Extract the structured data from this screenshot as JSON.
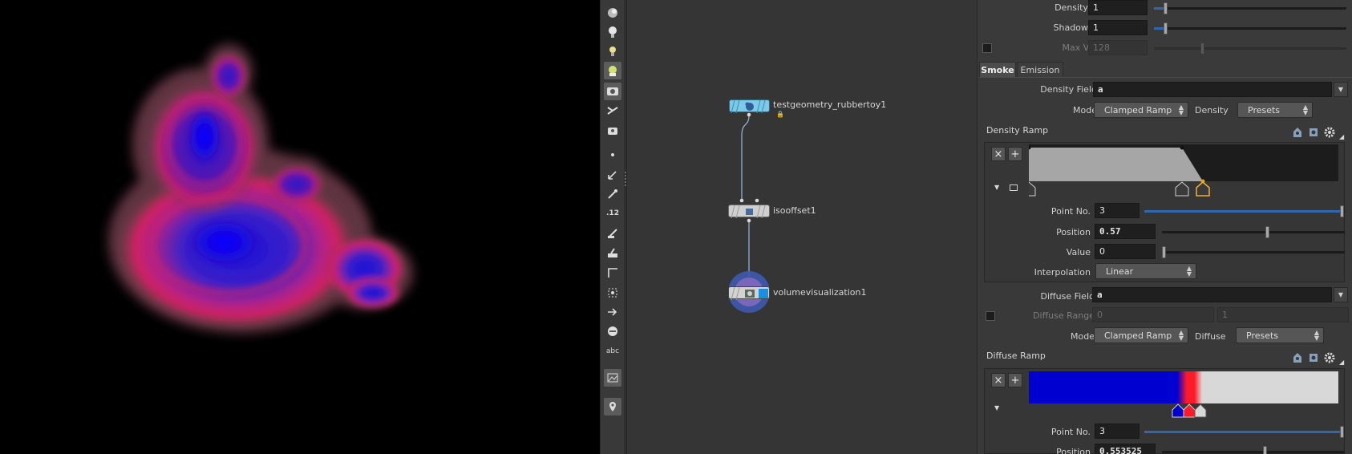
{
  "network": {
    "nodes": [
      {
        "name": "testgeometry_rubbertoy1"
      },
      {
        "name": "isooffset1"
      },
      {
        "name": "volumevisualization1"
      }
    ]
  },
  "toolbar": {
    "icons": [
      "display-options-icon",
      "light-icon",
      "light-bulb-icon",
      "camera-icon",
      "snapshot-icon",
      "visualizer-icon",
      "render-icon",
      "point-icon",
      "select-normal-icon",
      "pen-icon",
      "number-12-icon",
      "brush-icon",
      "paint-icon",
      "corner-icon",
      "grid-snap-icon",
      "arrow-tool-icon",
      "circle-icon",
      "text-abc-icon",
      "background-image-icon",
      "location-pin-icon"
    ]
  },
  "params": {
    "density_scale": {
      "label": "Density Scale",
      "value": "1",
      "slider": 0.05
    },
    "shadow_scale": {
      "label": "Shadow Scale",
      "value": "1",
      "slider": 0.05
    },
    "max_vis_res": {
      "label": "Max Vis Res",
      "value": "128"
    },
    "tabs": [
      {
        "label": "Smoke"
      },
      {
        "label": "Emission"
      }
    ],
    "density_field": {
      "label": "Density Field",
      "value": "a"
    },
    "density_mode": {
      "label": "Mode",
      "value": "Clamped Ramp",
      "aux_label": "Density",
      "presets": "Presets"
    },
    "density_ramp": {
      "title": "Density Ramp",
      "point_no": {
        "label": "Point No.",
        "value": "3",
        "slider": 1.0
      },
      "position": {
        "label": "Position",
        "value": "0.57",
        "slider": 0.57
      },
      "value": {
        "label": "Value",
        "value": "0",
        "slider": 0.0
      },
      "interpolation": {
        "label": "Interpolation",
        "value": "Linear"
      }
    },
    "diffuse_field": {
      "label": "Diffuse Field",
      "value": "a"
    },
    "diffuse_range": {
      "label": "Diffuse Range",
      "min": "0",
      "max": "1"
    },
    "diffuse_mode": {
      "label": "Mode",
      "value": "Clamped Ramp",
      "aux_label": "Diffuse",
      "presets": "Presets"
    },
    "diffuse_ramp": {
      "title": "Diffuse Ramp",
      "point_no": {
        "label": "Point No.",
        "value": "3",
        "slider": 1.0
      },
      "position": {
        "label": "Position",
        "value": "0.553525",
        "slider": 0.553525
      }
    }
  },
  "colors": {
    "accent": "#2f68b0",
    "node_cyan": "#6fc7e8",
    "diffuse_blue": "#0000d0",
    "diffuse_red": "#ff1a2a",
    "diffuse_white": "#d8d8d8"
  }
}
